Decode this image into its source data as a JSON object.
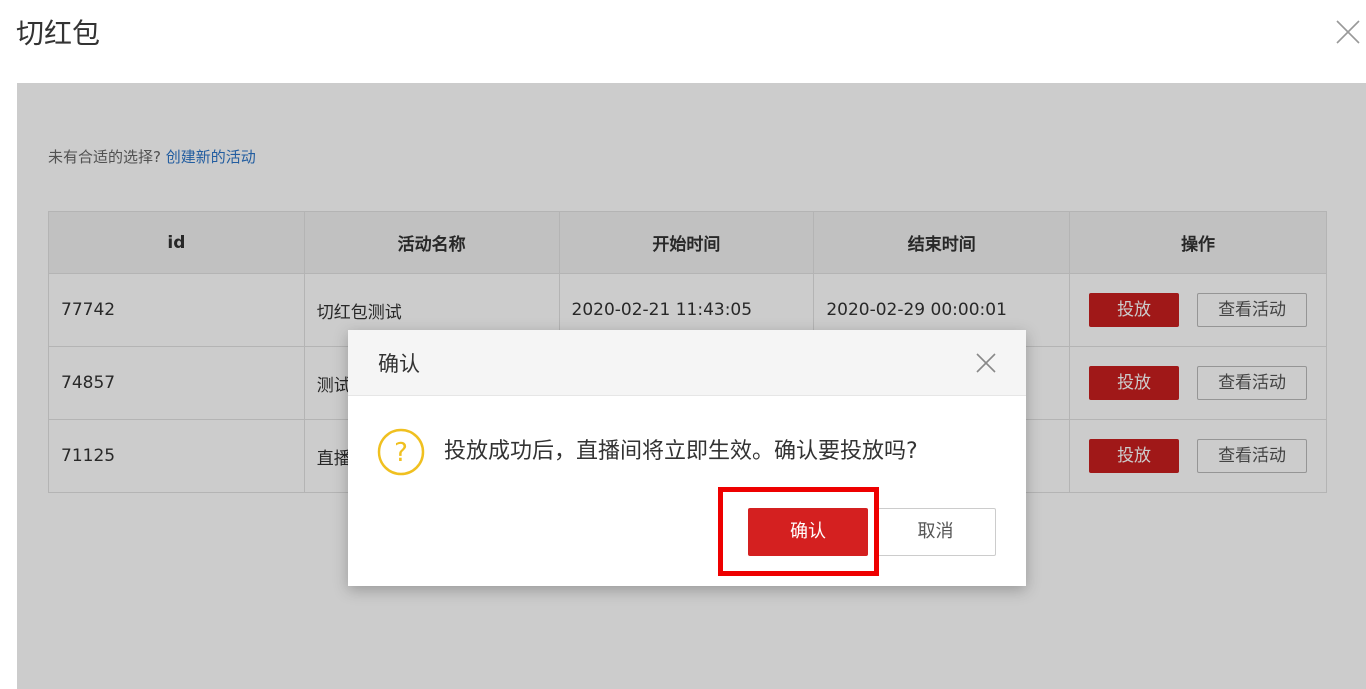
{
  "header": {
    "title": "切红包"
  },
  "hint": {
    "text": "未有合适的选择?",
    "link": "创建新的活动"
  },
  "table": {
    "headers": [
      "id",
      "活动名称",
      "开始时间",
      "结束时间",
      "操作"
    ],
    "rows": [
      {
        "id": "77742",
        "name": "切红包测试",
        "start": "2020-02-21 11:43:05",
        "end": "2020-02-29 00:00:01"
      },
      {
        "id": "74857",
        "name": "测试",
        "start": "",
        "end": ""
      },
      {
        "id": "71125",
        "name": "直播",
        "start": "",
        "end": ""
      }
    ],
    "action_put": "投放",
    "action_view": "查看活动"
  },
  "dialog": {
    "title": "确认",
    "message": "投放成功后，直播间将立即生效。确认要投放吗?",
    "ok_label": "确认",
    "cancel_label": "取消"
  },
  "colors": {
    "accent": "#d42020",
    "link": "#2b75c8",
    "highlight": "#ee0000",
    "question": "#f0c020"
  }
}
